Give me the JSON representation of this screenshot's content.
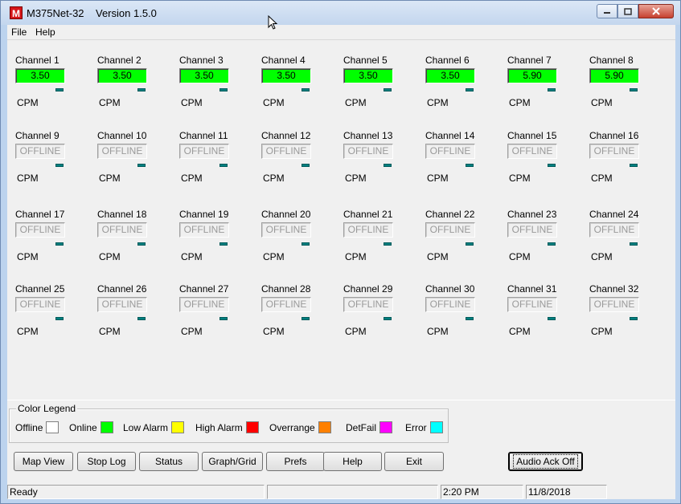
{
  "window": {
    "icon_letter": "M",
    "title": "M375Net-32",
    "version": "Version 1.5.0"
  },
  "menu": [
    "File",
    "Help"
  ],
  "channels": [
    {
      "label": "Channel 1",
      "value": "3.50",
      "unit": "CPM",
      "state": "online"
    },
    {
      "label": "Channel 2",
      "value": "3.50",
      "unit": "CPM",
      "state": "online"
    },
    {
      "label": "Channel 3",
      "value": "3.50",
      "unit": "CPM",
      "state": "online"
    },
    {
      "label": "Channel 4",
      "value": "3.50",
      "unit": "CPM",
      "state": "online"
    },
    {
      "label": "Channel 5",
      "value": "3.50",
      "unit": "CPM",
      "state": "online"
    },
    {
      "label": "Channel 6",
      "value": "3.50",
      "unit": "CPM",
      "state": "online"
    },
    {
      "label": "Channel 7",
      "value": "5.90",
      "unit": "CPM",
      "state": "online"
    },
    {
      "label": "Channel 8",
      "value": "5.90",
      "unit": "CPM",
      "state": "online"
    },
    {
      "label": "Channel 9",
      "value": "OFFLINE",
      "unit": "CPM",
      "state": "offline"
    },
    {
      "label": "Channel 10",
      "value": "OFFLINE",
      "unit": "CPM",
      "state": "offline"
    },
    {
      "label": "Channel 11",
      "value": "OFFLINE",
      "unit": "CPM",
      "state": "offline"
    },
    {
      "label": "Channel 12",
      "value": "OFFLINE",
      "unit": "CPM",
      "state": "offline"
    },
    {
      "label": "Channel 13",
      "value": "OFFLINE",
      "unit": "CPM",
      "state": "offline"
    },
    {
      "label": "Channel 14",
      "value": "OFFLINE",
      "unit": "CPM",
      "state": "offline"
    },
    {
      "label": "Channel 15",
      "value": "OFFLINE",
      "unit": "CPM",
      "state": "offline"
    },
    {
      "label": "Channel 16",
      "value": "OFFLINE",
      "unit": "CPM",
      "state": "offline"
    },
    {
      "label": "Channel 17",
      "value": "OFFLINE",
      "unit": "CPM",
      "state": "offline"
    },
    {
      "label": "Channel 18",
      "value": "OFFLINE",
      "unit": "CPM",
      "state": "offline"
    },
    {
      "label": "Channel 19",
      "value": "OFFLINE",
      "unit": "CPM",
      "state": "offline"
    },
    {
      "label": "Channel 20",
      "value": "OFFLINE",
      "unit": "CPM",
      "state": "offline"
    },
    {
      "label": "Channel 21",
      "value": "OFFLINE",
      "unit": "CPM",
      "state": "offline"
    },
    {
      "label": "Channel 22",
      "value": "OFFLINE",
      "unit": "CPM",
      "state": "offline"
    },
    {
      "label": "Channel 23",
      "value": "OFFLINE",
      "unit": "CPM",
      "state": "offline"
    },
    {
      "label": "Channel 24",
      "value": "OFFLINE",
      "unit": "CPM",
      "state": "offline"
    },
    {
      "label": "Channel 25",
      "value": "OFFLINE",
      "unit": "CPM",
      "state": "offline"
    },
    {
      "label": "Channel 26",
      "value": "OFFLINE",
      "unit": "CPM",
      "state": "offline"
    },
    {
      "label": "Channel 27",
      "value": "OFFLINE",
      "unit": "CPM",
      "state": "offline"
    },
    {
      "label": "Channel 28",
      "value": "OFFLINE",
      "unit": "CPM",
      "state": "offline"
    },
    {
      "label": "Channel 29",
      "value": "OFFLINE",
      "unit": "CPM",
      "state": "offline"
    },
    {
      "label": "Channel 30",
      "value": "OFFLINE",
      "unit": "CPM",
      "state": "offline"
    },
    {
      "label": "Channel 31",
      "value": "OFFLINE",
      "unit": "CPM",
      "state": "offline"
    },
    {
      "label": "Channel 32",
      "value": "OFFLINE",
      "unit": "CPM",
      "state": "offline"
    }
  ],
  "legend": {
    "title": "Color Legend",
    "items": [
      {
        "label": "Offline",
        "color": "#ffffff"
      },
      {
        "label": "Online",
        "color": "#00ff00"
      },
      {
        "label": "Low Alarm",
        "color": "#ffff00"
      },
      {
        "label": "High Alarm",
        "color": "#ff0000"
      },
      {
        "label": "Overrange",
        "color": "#ff8000"
      },
      {
        "label": "DetFail",
        "color": "#ff00ff"
      },
      {
        "label": "Error",
        "color": "#00ffff"
      }
    ]
  },
  "buttons": {
    "map_view": "Map View",
    "stop_log": "Stop Log",
    "status": "Status",
    "graph_grid": "Graph/Grid",
    "prefs": "Prefs",
    "help": "Help",
    "exit": "Exit",
    "audio_ack": "Audio Ack Off"
  },
  "status": {
    "message": "Ready",
    "panel2": "",
    "time": "2:20 PM",
    "date": "11/8/2018"
  },
  "colors": {
    "online": "#00ff00",
    "led": "#008080"
  }
}
